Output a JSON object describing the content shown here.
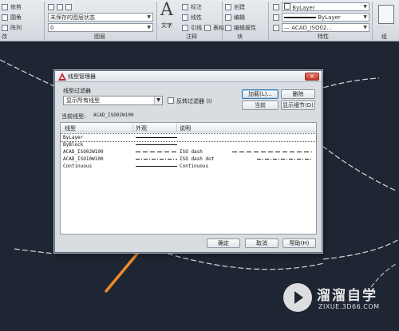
{
  "ribbon": {
    "left_panel": {
      "label": "改",
      "row1": "修剪",
      "row2": "圆角",
      "row3": "阵列"
    },
    "layers_panel": {
      "label": "图层",
      "state_combo": "未保存的图层状态",
      "layer_combo": "0"
    },
    "annotation_panel": {
      "label": "注释",
      "text_label": "文字",
      "tools": [
        "标注",
        "线性",
        "引线",
        "表格"
      ]
    },
    "block_panel": {
      "label": "块",
      "tools": [
        "创建",
        "编辑",
        "编辑属性"
      ]
    },
    "properties_panel": {
      "label": "特性",
      "color_combo": "ByLayer",
      "lineweight_combo": "ByLayer",
      "linetype_combo": "— ACAD_ISO02..."
    },
    "group_panel": {
      "label": "组"
    }
  },
  "dialog": {
    "title": "线型管理器",
    "filter_label": "线型过滤器",
    "filter_value": "显示所有线型",
    "invert_label": "反转过滤器 (I)",
    "load_button": "加载(L)...",
    "delete_button": "删除",
    "current_button": "当前",
    "details_button": "显示细节(D)",
    "current_linetype_label": "当前线型:",
    "current_linetype_value": "ACAD_ISO02W100",
    "columns": [
      "线型",
      "外观",
      "说明"
    ],
    "rows": [
      {
        "name": "ByLayer",
        "appearance": "",
        "desc": "",
        "desc2": "",
        "style": "solid"
      },
      {
        "name": "ByBlock",
        "appearance": "",
        "desc": "",
        "desc2": "",
        "style": "solid"
      },
      {
        "name": "ACAD_ISO02W100",
        "appearance": "",
        "desc": "ISO dash",
        "desc2": "",
        "style": "dash1"
      },
      {
        "name": "ACAD_ISO10W100",
        "appearance": "",
        "desc": "ISO dash dot",
        "desc2": "",
        "style": "dash2"
      },
      {
        "name": "Continuous",
        "appearance": "",
        "desc": "Continuous",
        "desc2": "",
        "style": "solid"
      }
    ],
    "ok_button": "确定",
    "cancel_button": "取消",
    "help_button": "帮助(H)"
  },
  "watermark": {
    "name": "溜溜自学",
    "url": "ZIXUE.3D66.COM"
  },
  "colors": {
    "canvas_bg": "#1f2633",
    "arrow": "#f08a28",
    "dialog_bg": "#d9dde2"
  }
}
